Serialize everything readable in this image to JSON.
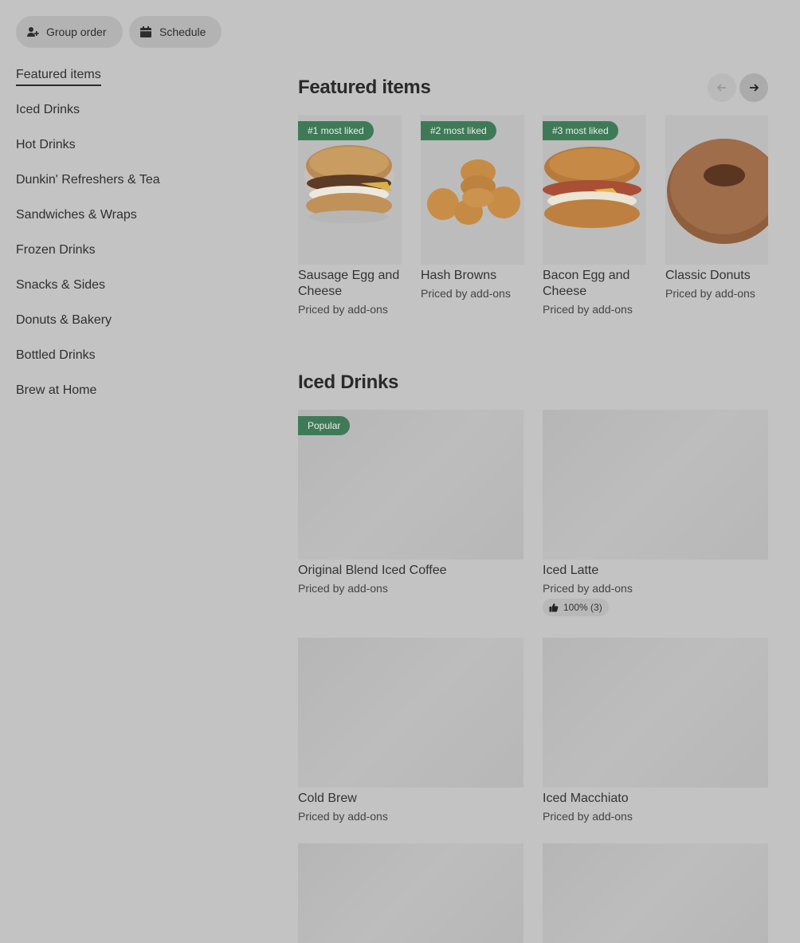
{
  "top_actions": {
    "group_order": "Group order",
    "schedule": "Schedule"
  },
  "sidebar": {
    "items": [
      {
        "label": "Featured items",
        "active": true
      },
      {
        "label": "Iced Drinks"
      },
      {
        "label": "Hot Drinks"
      },
      {
        "label": "Dunkin' Refreshers & Tea"
      },
      {
        "label": "Sandwiches & Wraps"
      },
      {
        "label": "Frozen Drinks"
      },
      {
        "label": "Snacks & Sides"
      },
      {
        "label": "Donuts & Bakery"
      },
      {
        "label": "Bottled Drinks"
      },
      {
        "label": "Brew at Home"
      }
    ]
  },
  "featured": {
    "title": "Featured items",
    "items": [
      {
        "badge": "#1 most liked",
        "name": "Sausage Egg and Cheese",
        "price": "Priced by add-ons",
        "image_icon": "sandwich-image"
      },
      {
        "badge": "#2 most liked",
        "name": "Hash Browns",
        "price": "Priced by add-ons",
        "image_icon": "hash-browns-image"
      },
      {
        "badge": "#3 most liked",
        "name": "Bacon Egg and Cheese",
        "price": "Priced by add-ons",
        "image_icon": "bagel-sandwich-image"
      },
      {
        "badge": "",
        "name": "Classic Donuts",
        "price": "Priced by add-ons",
        "image_icon": "donut-image"
      }
    ]
  },
  "iced": {
    "title": "Iced Drinks",
    "items": [
      {
        "badge": "Popular",
        "name": "Original Blend Iced Coffee",
        "price": "Priced by add-ons"
      },
      {
        "name": "Iced Latte",
        "price": "Priced by add-ons",
        "rating": "100% (3)"
      },
      {
        "name": "Cold Brew",
        "price": "Priced by add-ons"
      },
      {
        "name": "Iced Macchiato",
        "price": "Priced by add-ons"
      }
    ]
  },
  "colors": {
    "background": "#c3c3c3",
    "badge_green": "#3f7a57"
  }
}
